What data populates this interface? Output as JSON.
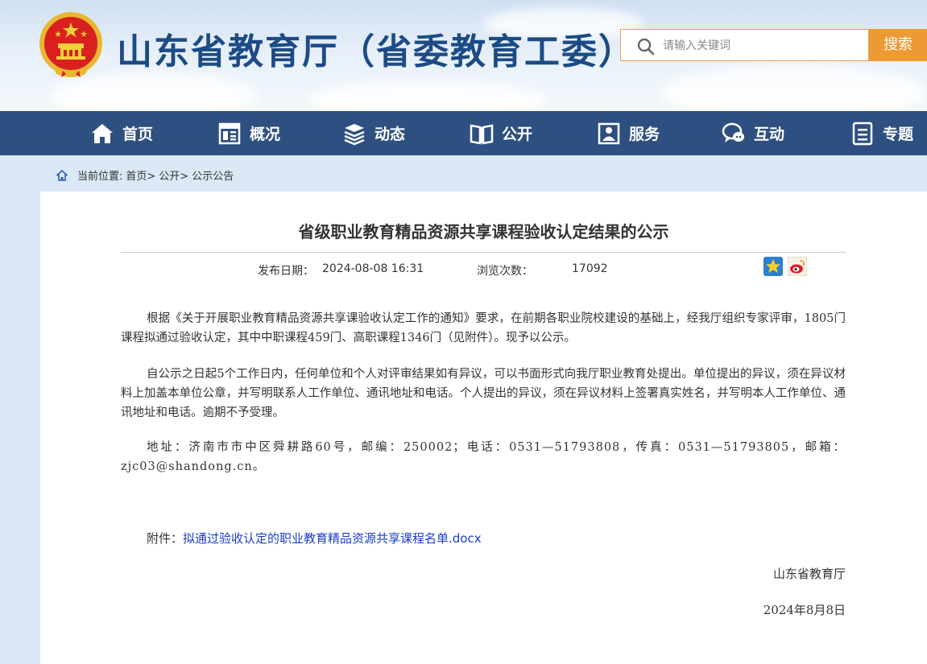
{
  "header": {
    "site_title": "山东省教育厅（省委教育工委）",
    "search_placeholder": "请输入关键词",
    "search_button": "搜索"
  },
  "nav": {
    "items": [
      {
        "label": "首页",
        "icon": "home-icon"
      },
      {
        "label": "概况",
        "icon": "overview-icon"
      },
      {
        "label": "动态",
        "icon": "news-stack-icon"
      },
      {
        "label": "公开",
        "icon": "open-book-icon"
      },
      {
        "label": "服务",
        "icon": "service-icon"
      },
      {
        "label": "互动",
        "icon": "chat-icon"
      },
      {
        "label": "专题",
        "icon": "topic-icon"
      }
    ]
  },
  "breadcrumb": {
    "prefix": "当前位置:",
    "items": [
      "首页>",
      "公开>",
      "公示公告"
    ]
  },
  "article": {
    "title": "省级职业教育精品资源共享课程验收认定结果的公示",
    "publish_label": "发布日期：",
    "publish_date": "2024-08-08 16:31",
    "views_label": "浏览次数：",
    "views": "17092",
    "paragraphs": [
      "根据《关于开展职业教育精品资源共享课验收认定工作的通知》要求，在前期各职业院校建设的基础上，经我厅组织专家评审，1805门课程拟通过验收认定，其中中职课程459门、高职课程1346门（见附件）。现予以公示。",
      "自公示之日起5个工作日内，任何单位和个人对评审结果如有异议，可以书面形式向我厅职业教育处提出。单位提出的异议，须在异议材料上加盖本单位公章，并写明联系人工作单位、通讯地址和电话。个人提出的异议，须在异议材料上签署真实姓名，并写明本人工作单位、通讯地址和电话。逾期不予受理。",
      "地址：济南市市中区舜耕路60号，邮编：250002；电话：0531—51793808，传真：0531—51793805，邮箱：zjc03@shandong.cn。"
    ],
    "attachment_label": "附件：",
    "attachment_link": "拟通过验收认定的职业教育精品资源共享课程名单.docx",
    "signature": "山东省教育厅",
    "sign_date": "2024年8月8日"
  },
  "colors": {
    "nav_bg": "#2e5080",
    "title_blue": "#1c4b86",
    "search_orange": "#eb9a34",
    "link_blue": "#1a3ec9"
  }
}
